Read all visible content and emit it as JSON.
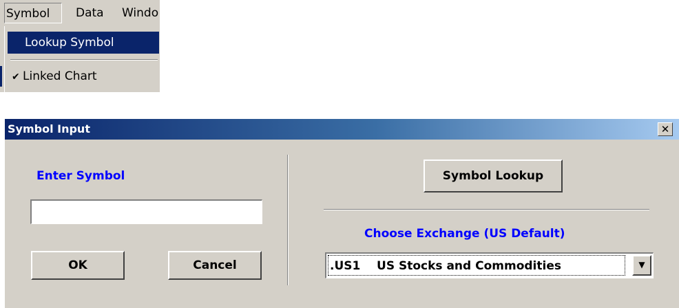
{
  "menubar": {
    "items": [
      {
        "label": "Symbol"
      },
      {
        "label": "Data"
      },
      {
        "label": "Windo"
      }
    ]
  },
  "dropdown": {
    "items": [
      {
        "label": "Lookup Symbol",
        "highlighted": true
      },
      {
        "label": "Linked Chart",
        "checked": true,
        "icon": "checkmark-icon"
      }
    ]
  },
  "dialog": {
    "title": "Symbol Input",
    "close_glyph": "✕",
    "enter_symbol_label": "Enter Symbol",
    "symbol_input_value": "",
    "ok_label": "OK",
    "cancel_label": "Cancel",
    "symbol_lookup_label": "Symbol Lookup",
    "choose_exchange_label": "Choose Exchange   (US Default)",
    "exchange_selected": ".US1    US Stocks and Commodities"
  },
  "colors": {
    "title_gradient_start": "#0a246a",
    "title_gradient_end": "#a6caf0",
    "face": "#d4d0c8",
    "highlight": "#0a246a",
    "label_blue": "#0000ff"
  }
}
